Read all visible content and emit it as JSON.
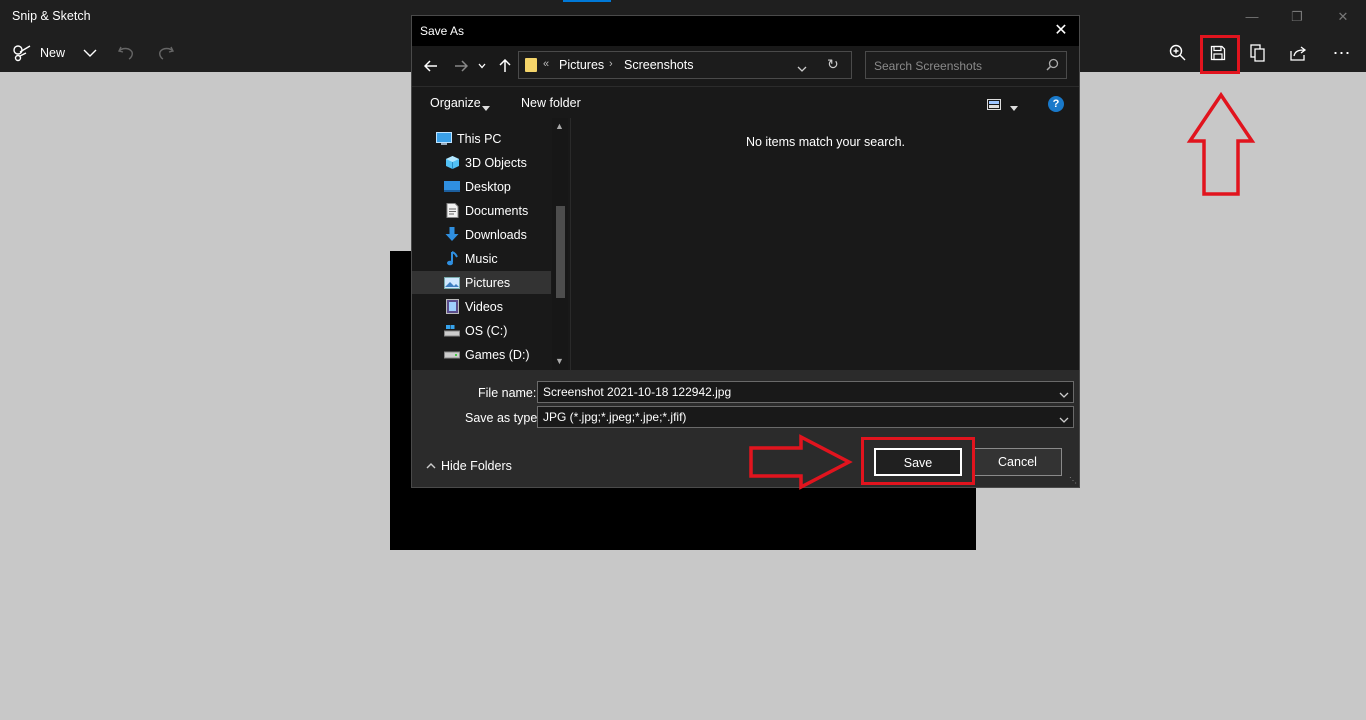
{
  "app": {
    "title": "Snip & Sketch",
    "new_label": "New",
    "window_controls": [
      "minimize-icon",
      "restore-icon",
      "close-icon"
    ],
    "toolbar_icons": [
      "zoom-icon",
      "save-icon",
      "copy-icon",
      "share-icon",
      "more-icon"
    ],
    "accent_color": "#0078d7"
  },
  "dialog": {
    "title": "Save As",
    "breadcrumb": {
      "overflow": "«",
      "items": [
        "Pictures",
        "Screenshots"
      ]
    },
    "search_placeholder": "Search Screenshots",
    "commands": {
      "organize": "Organize",
      "new_folder": "New folder",
      "help": "?"
    },
    "nav_items": [
      {
        "label": "This PC",
        "icon": "pc-icon"
      },
      {
        "label": "3D Objects",
        "icon": "cube-icon"
      },
      {
        "label": "Desktop",
        "icon": "desktop-icon"
      },
      {
        "label": "Documents",
        "icon": "document-icon"
      },
      {
        "label": "Downloads",
        "icon": "download-icon"
      },
      {
        "label": "Music",
        "icon": "music-icon"
      },
      {
        "label": "Pictures",
        "icon": "pictures-icon",
        "selected": true
      },
      {
        "label": "Videos",
        "icon": "videos-icon"
      },
      {
        "label": "OS (C:)",
        "icon": "drive-icon"
      },
      {
        "label": "Games (D:)",
        "icon": "drive-icon"
      }
    ],
    "empty_message": "No items match your search.",
    "file_name_label": "File name:",
    "file_name_value": "Screenshot 2021-10-18 122942.jpg",
    "save_type_label": "Save as type:",
    "save_type_value": "JPG (*.jpg;*.jpeg;*.jpe;*.jfif)",
    "hide_folders": "Hide Folders",
    "save_button": "Save",
    "cancel_button": "Cancel"
  },
  "annotation_color": "#e1141e"
}
